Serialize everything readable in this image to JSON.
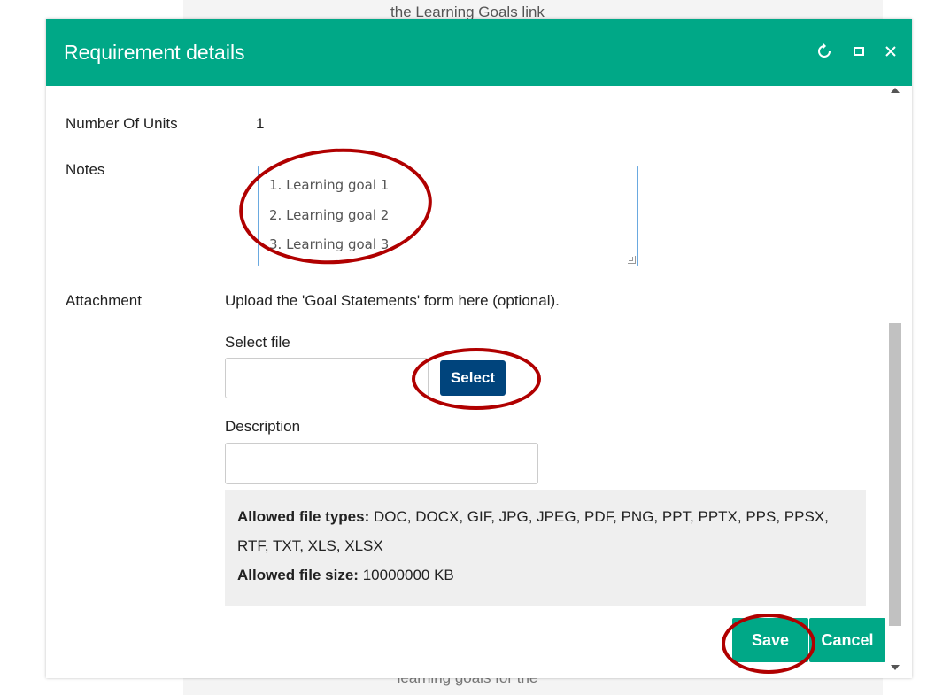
{
  "background": {
    "top_text": "the Learning Goals link",
    "bottom_text": "learning goals for the"
  },
  "dialog": {
    "title": "Requirement details",
    "controls": {
      "refresh_icon": "refresh-icon",
      "maximize_icon": "maximize-icon",
      "close_icon": "close-icon"
    }
  },
  "form": {
    "units_label": "Number Of Units",
    "units_value": "1",
    "notes_label": "Notes",
    "notes_lines": [
      "1. Learning goal 1",
      "2. Learning goal 2",
      "3. Learning goal 3"
    ],
    "attachment_label": "Attachment",
    "attachment_hint": "Upload the 'Goal Statements' form here (optional).",
    "select_file_label": "Select file",
    "select_button": "Select",
    "description_label": "Description",
    "allowed_types_label": "Allowed file types:",
    "allowed_types_value": "DOC, DOCX, GIF, JPG, JPEG, PDF, PNG, PPT, PPTX, PPS, PPSX,",
    "allowed_types_value2": "RTF, TXT, XLS, XLSX",
    "allowed_size_label": "Allowed file size:",
    "allowed_size_value": "10000000 KB"
  },
  "footer": {
    "save_button": "Save",
    "cancel_button": "Cancel"
  },
  "colors": {
    "header": "#00a887",
    "select_button": "#00447c",
    "annotation": "#b00000"
  }
}
